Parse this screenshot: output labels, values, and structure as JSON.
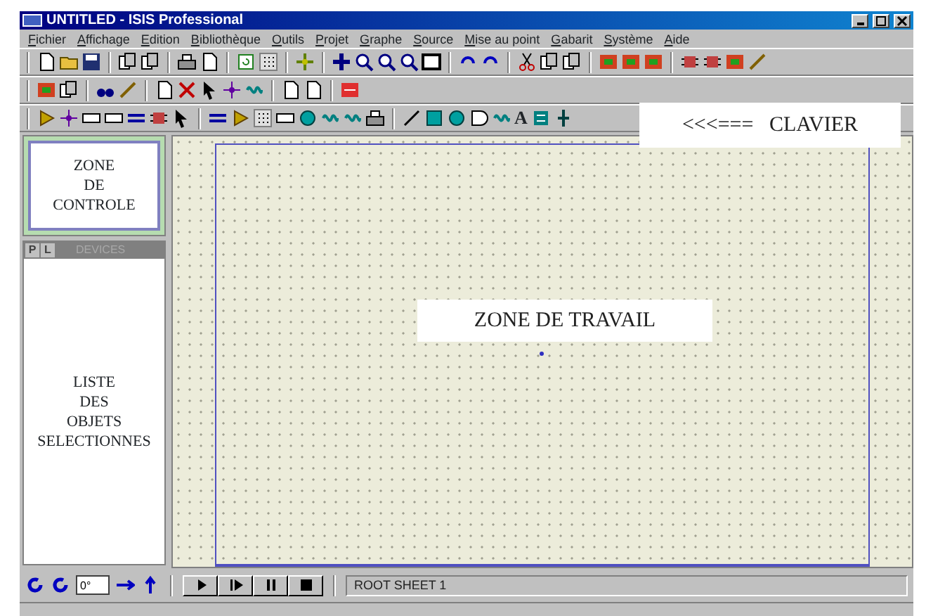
{
  "window": {
    "title": "UNTITLED - ISIS Professional"
  },
  "menu": [
    "Fichier",
    "Affichage",
    "Edition",
    "Bibliothèque",
    "Outils",
    "Projet",
    "Graphe",
    "Source",
    "Mise au point",
    "Gabarit",
    "Système",
    "Aide"
  ],
  "toolbar_text_tool": "A",
  "keyboard_note": "<<<===   CLAVIER",
  "control_zone": {
    "lines": [
      "ZONE",
      "DE",
      "CONTROLE"
    ]
  },
  "selector": {
    "tabs": [
      "P",
      "L"
    ],
    "header": "DEVICES",
    "header_disabled": true,
    "lines": [
      "LISTE",
      "DES",
      "OBJETS",
      "SELECTIONNES"
    ]
  },
  "work_zone": "ZONE DE TRAVAIL",
  "bottom_bar": {
    "angle": "0°",
    "status": "ROOT SHEET 1"
  }
}
